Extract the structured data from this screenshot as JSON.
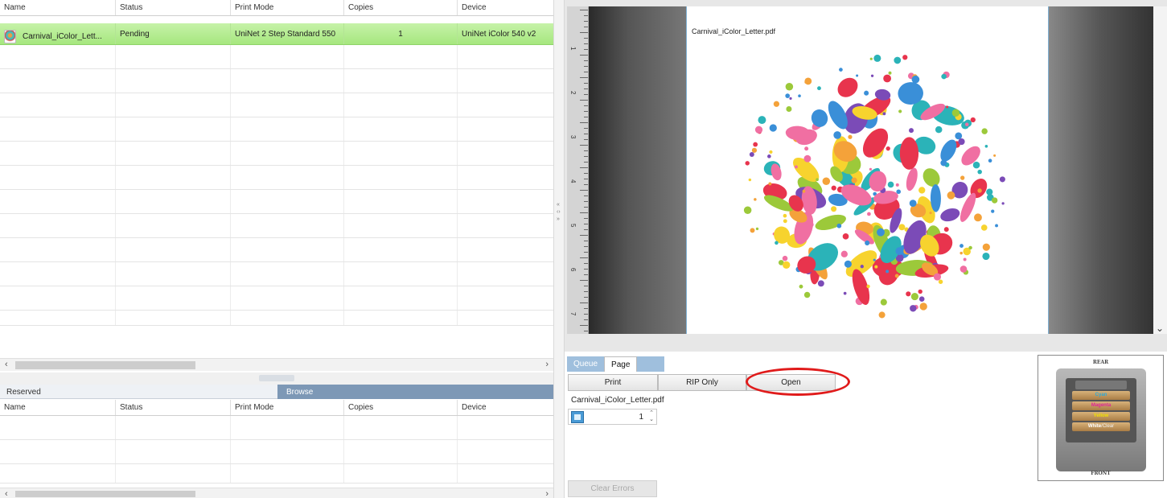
{
  "queue_table": {
    "columns": [
      "Name",
      "Status",
      "Print Mode",
      "Copies",
      "Device"
    ],
    "rows": [
      {
        "name": "Carnival_iColor_Lett...",
        "status": "Pending",
        "print_mode": "UniNet 2 Step Standard 550",
        "copies": "1",
        "device": "UniNet iColor 540 v2"
      }
    ]
  },
  "lower_tabs": {
    "reserved": "Reserved",
    "browse": "Browse"
  },
  "browse_table": {
    "columns": [
      "Name",
      "Status",
      "Print Mode",
      "Copies",
      "Device"
    ]
  },
  "preview": {
    "filename": "Carnival_iColor_Letter.pdf",
    "ruler_labels": [
      "1",
      "2",
      "3",
      "4",
      "5",
      "6",
      "7"
    ]
  },
  "job_panel": {
    "tabs": [
      "Queue",
      "Page"
    ],
    "buttons": {
      "print": "Print",
      "rip_only": "RIP Only",
      "open": "Open"
    },
    "filename": "Carnival_iColor_Letter.pdf",
    "copies_value": "1",
    "clear_errors": "Clear Errors"
  },
  "tray": {
    "rear": "REAR",
    "front": "FRONT",
    "slots": [
      "Cyan",
      "Magenta",
      "Yellow",
      "White"
    ],
    "clear_label": "/Clear"
  },
  "colors": {
    "highlight_circle": "#e01b1b",
    "selected_row": "#a6e77f",
    "browse_tab": "#7d98b6"
  }
}
